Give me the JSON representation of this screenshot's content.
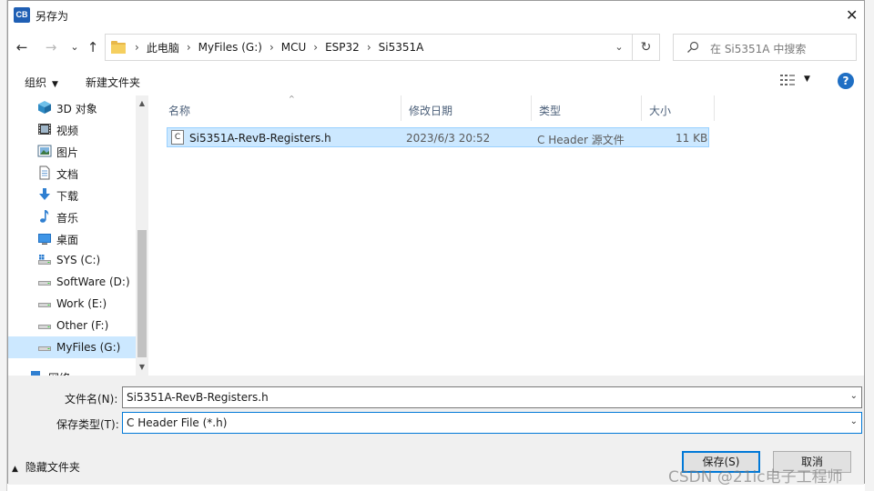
{
  "window": {
    "app_icon_text": "CB",
    "title": "另存为",
    "close_glyph": "✕"
  },
  "nav": {
    "back_glyph": "←",
    "forward_glyph": "→",
    "recent_glyph": "⌄",
    "up_glyph": "↑",
    "breadcrumbs": [
      "此电脑",
      "MyFiles (G:)",
      "MCU",
      "ESP32",
      "Si5351A"
    ],
    "separator": "›",
    "dropdown_glyph": "⌄",
    "refresh_glyph": "↻",
    "search_placeholder": "在 Si5351A 中搜索"
  },
  "toolbar": {
    "organize_label": "组织",
    "organize_caret": "▼",
    "new_folder_label": "新建文件夹",
    "view_caret": "▼",
    "help_glyph": "?"
  },
  "sidebar": {
    "items": [
      {
        "label": "3D 对象",
        "icon": "3d-objects-icon"
      },
      {
        "label": "视频",
        "icon": "video-icon"
      },
      {
        "label": "图片",
        "icon": "pictures-icon"
      },
      {
        "label": "文档",
        "icon": "documents-icon"
      },
      {
        "label": "下载",
        "icon": "downloads-icon"
      },
      {
        "label": "音乐",
        "icon": "music-icon"
      },
      {
        "label": "桌面",
        "icon": "desktop-icon"
      },
      {
        "label": "SYS (C:)",
        "icon": "system-drive-icon"
      },
      {
        "label": "SoftWare (D:)",
        "icon": "drive-icon"
      },
      {
        "label": "Work (E:)",
        "icon": "drive-icon"
      },
      {
        "label": "Other (F:)",
        "icon": "drive-icon"
      },
      {
        "label": "MyFiles (G:)",
        "icon": "drive-icon",
        "selected": true
      },
      {
        "label": "网络",
        "icon": "network-icon"
      }
    ],
    "scroll_up": "▲",
    "scroll_down": "▼"
  },
  "filelist": {
    "columns": [
      "名称",
      "修改日期",
      "类型",
      "大小"
    ],
    "sort_glyph": "^",
    "rows": [
      {
        "name": "Si5351A-RevB-Registers.h",
        "date": "2023/6/3 20:52",
        "type": "C Header 源文件",
        "size": "11 KB",
        "icon_letter": "C"
      }
    ]
  },
  "form": {
    "filename_label": "文件名(N):",
    "filename_value": "Si5351A-RevB-Registers.h",
    "filetype_label": "保存类型(T):",
    "filetype_value": "C Header File (*.h)",
    "caret": "⌄",
    "hide_folders_label": "隐藏文件夹",
    "hide_caret": "▲",
    "save_label": "保存(S)",
    "cancel_label": "取消"
  },
  "watermark": "CSDN @21ic电子工程师",
  "colors": {
    "accent": "#0078d7",
    "selection": "#cce8ff",
    "selection_border": "#99d1ff",
    "help": "#1f6fc4"
  }
}
